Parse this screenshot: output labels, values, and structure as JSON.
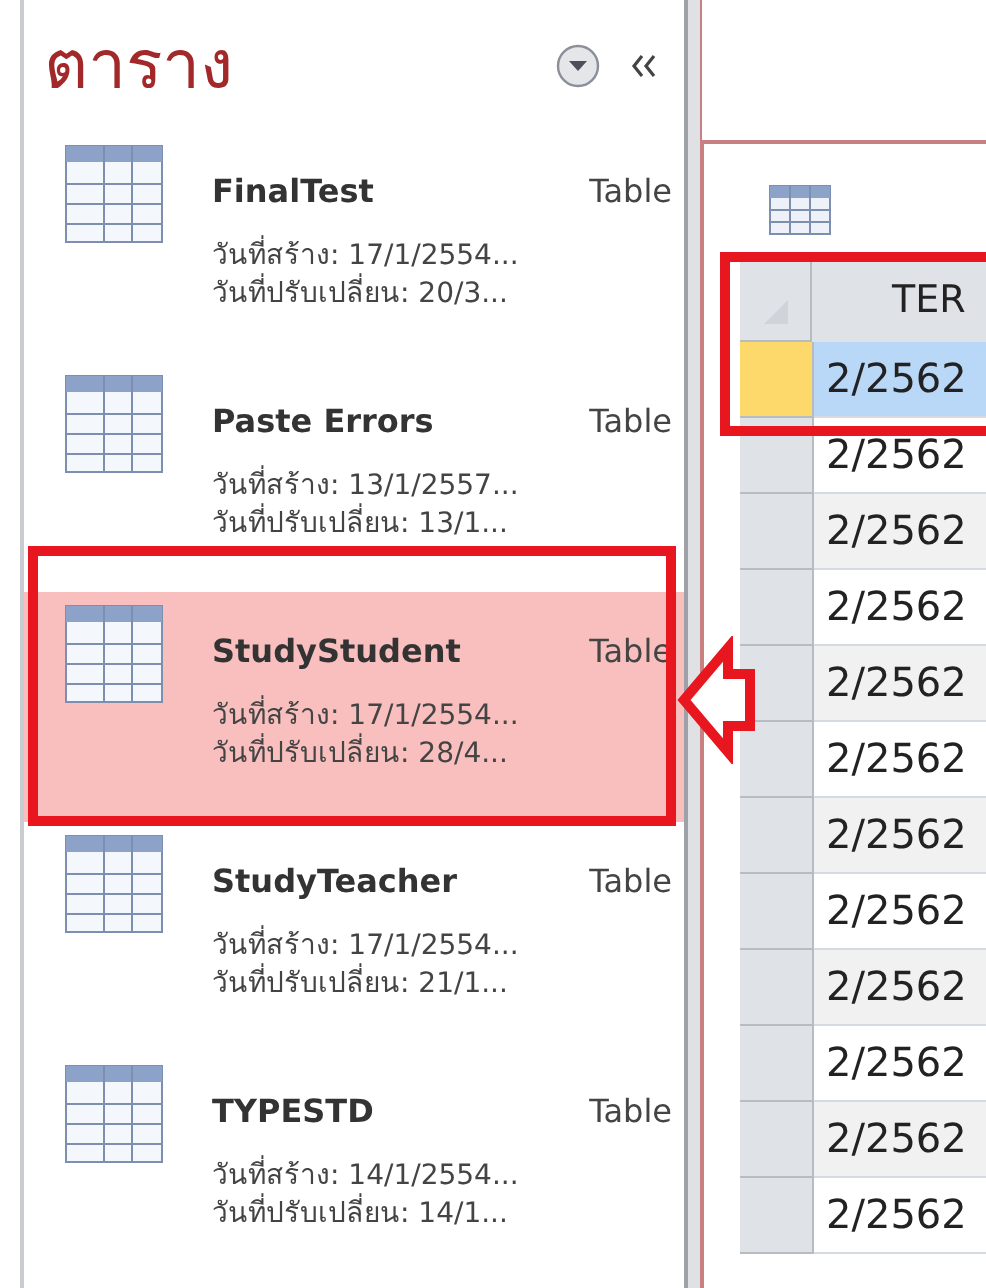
{
  "nav_pane": {
    "title": "ตาราง",
    "items": [
      {
        "name": "FinalTest",
        "type": "Table",
        "created": "วันที่สร้าง: 17/1/2554...",
        "modified": "วันที่ปรับเปลี่ยน: 20/3...",
        "selected": false
      },
      {
        "name": "Paste Errors",
        "type": "Table",
        "created": "วันที่สร้าง: 13/1/2557...",
        "modified": "วันที่ปรับเปลี่ยน: 13/1...",
        "selected": false
      },
      {
        "name": "StudyStudent",
        "type": "Table",
        "created": "วันที่สร้าง: 17/1/2554...",
        "modified": "วันที่ปรับเปลี่ยน: 28/4...",
        "selected": true
      },
      {
        "name": "StudyTeacher",
        "type": "Table",
        "created": "วันที่สร้าง: 17/1/2554...",
        "modified": "วันที่ปรับเปลี่ยน: 21/1...",
        "selected": false
      },
      {
        "name": "TYPESTD",
        "type": "Table",
        "created": "วันที่สร้าง: 14/1/2554...",
        "modified": "วันที่ปรับเปลี่ยน: 14/1...",
        "selected": false
      }
    ]
  },
  "datasheet": {
    "columns": [
      "TER"
    ],
    "rows": [
      {
        "cells": [
          "2/2562"
        ],
        "selected": true
      },
      {
        "cells": [
          "2/2562"
        ],
        "selected": false
      },
      {
        "cells": [
          "2/2562"
        ],
        "selected": false
      },
      {
        "cells": [
          "2/2562"
        ],
        "selected": false
      },
      {
        "cells": [
          "2/2562"
        ],
        "selected": false
      },
      {
        "cells": [
          "2/2562"
        ],
        "selected": false
      },
      {
        "cells": [
          "2/2562"
        ],
        "selected": false
      },
      {
        "cells": [
          "2/2562"
        ],
        "selected": false
      },
      {
        "cells": [
          "2/2562"
        ],
        "selected": false
      },
      {
        "cells": [
          "2/2562"
        ],
        "selected": false
      },
      {
        "cells": [
          "2/2562"
        ],
        "selected": false
      },
      {
        "cells": [
          "2/2562"
        ],
        "selected": false
      }
    ]
  }
}
